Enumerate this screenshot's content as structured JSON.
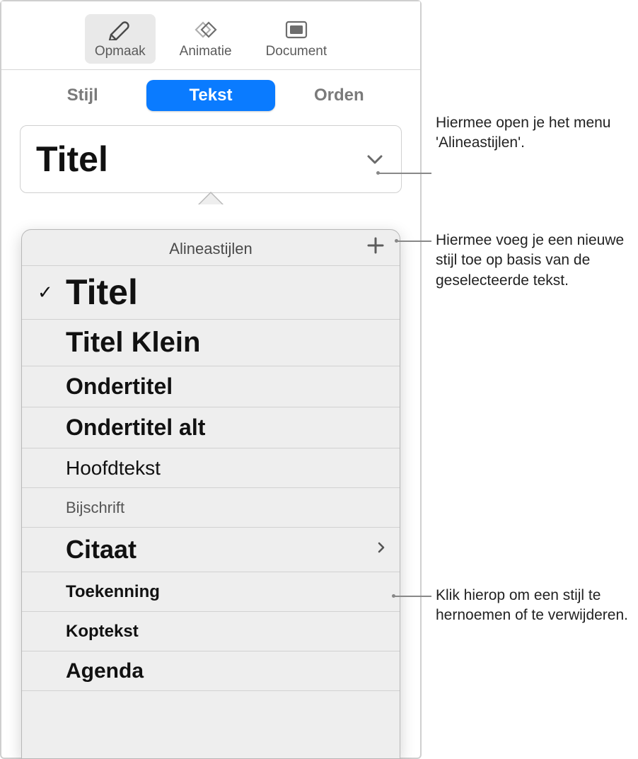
{
  "toolbar": {
    "format": "Opmaak",
    "animate": "Animatie",
    "document": "Document"
  },
  "tabs": {
    "style": "Stijl",
    "text": "Tekst",
    "order": "Orden"
  },
  "style_field": {
    "current": "Titel"
  },
  "popover": {
    "title": "Alineastijlen",
    "styles": [
      {
        "label": "Titel",
        "selected": true,
        "css": "style-titel"
      },
      {
        "label": "Titel Klein",
        "selected": false,
        "css": "style-titel-klein"
      },
      {
        "label": "Ondertitel",
        "selected": false,
        "css": "style-ondertitel"
      },
      {
        "label": "Ondertitel alt",
        "selected": false,
        "css": "style-ondertitel-alt"
      },
      {
        "label": "Hoofdtekst",
        "selected": false,
        "css": "style-hoofdtekst"
      },
      {
        "label": "Bijschrift",
        "selected": false,
        "css": "style-bijschrift"
      },
      {
        "label": "Citaat",
        "selected": false,
        "css": "style-citaat",
        "chevron": true
      },
      {
        "label": "Toekenning",
        "selected": false,
        "css": "style-toekenning"
      },
      {
        "label": "Koptekst",
        "selected": false,
        "css": "style-koptekst"
      },
      {
        "label": "Agenda",
        "selected": false,
        "css": "style-agenda"
      }
    ]
  },
  "callouts": {
    "open_menu": "Hiermee open je het menu 'Alineastijlen'.",
    "add_style": "Hiermee voeg je een nieuwe stijl toe op basis van de geselecteerde tekst.",
    "rename_delete": "Klik hierop om een stijl te hernoemen of te verwijderen."
  }
}
